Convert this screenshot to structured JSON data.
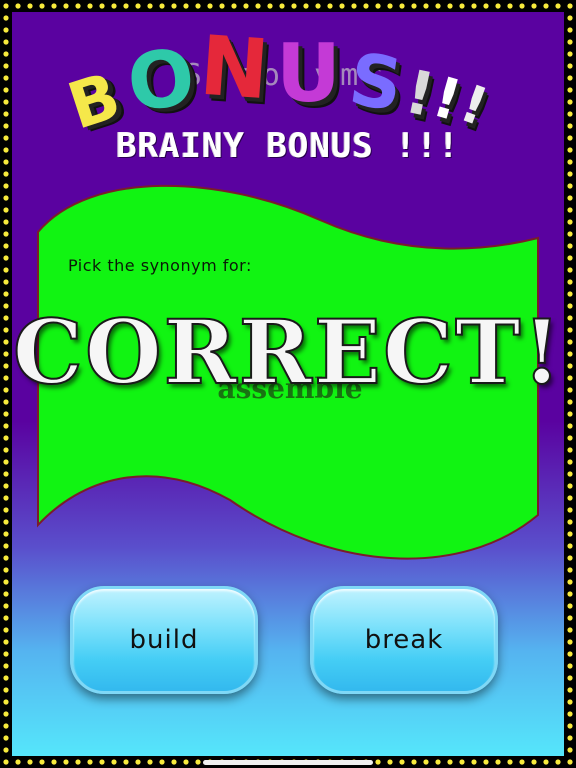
{
  "header": {
    "watermark_word": "Synonyms",
    "bonus_letters": [
      "B",
      "O",
      "N",
      "U",
      "S",
      "!",
      "!",
      "!"
    ],
    "bonus_colors": [
      "#f5e84a",
      "#2ec9a9",
      "#e5283a",
      "#c43ad6",
      "#7a6cff",
      "#d9d9d9",
      "#ffffff",
      "#eeeeee"
    ],
    "subtitle": "BRAINY BONUS !!!"
  },
  "question": {
    "prompt": "Pick the synonym for:",
    "word": "assemble",
    "result": "CORRECT!"
  },
  "answers": [
    {
      "label": "build"
    },
    {
      "label": "break"
    }
  ],
  "colors": {
    "background_top": "#5a02a0",
    "background_bottom": "#55e6fb",
    "banner_fill": "#11f412",
    "banner_border": "#7a1d2a",
    "dots": "#f7ea3c",
    "button": "#44cdf5"
  }
}
